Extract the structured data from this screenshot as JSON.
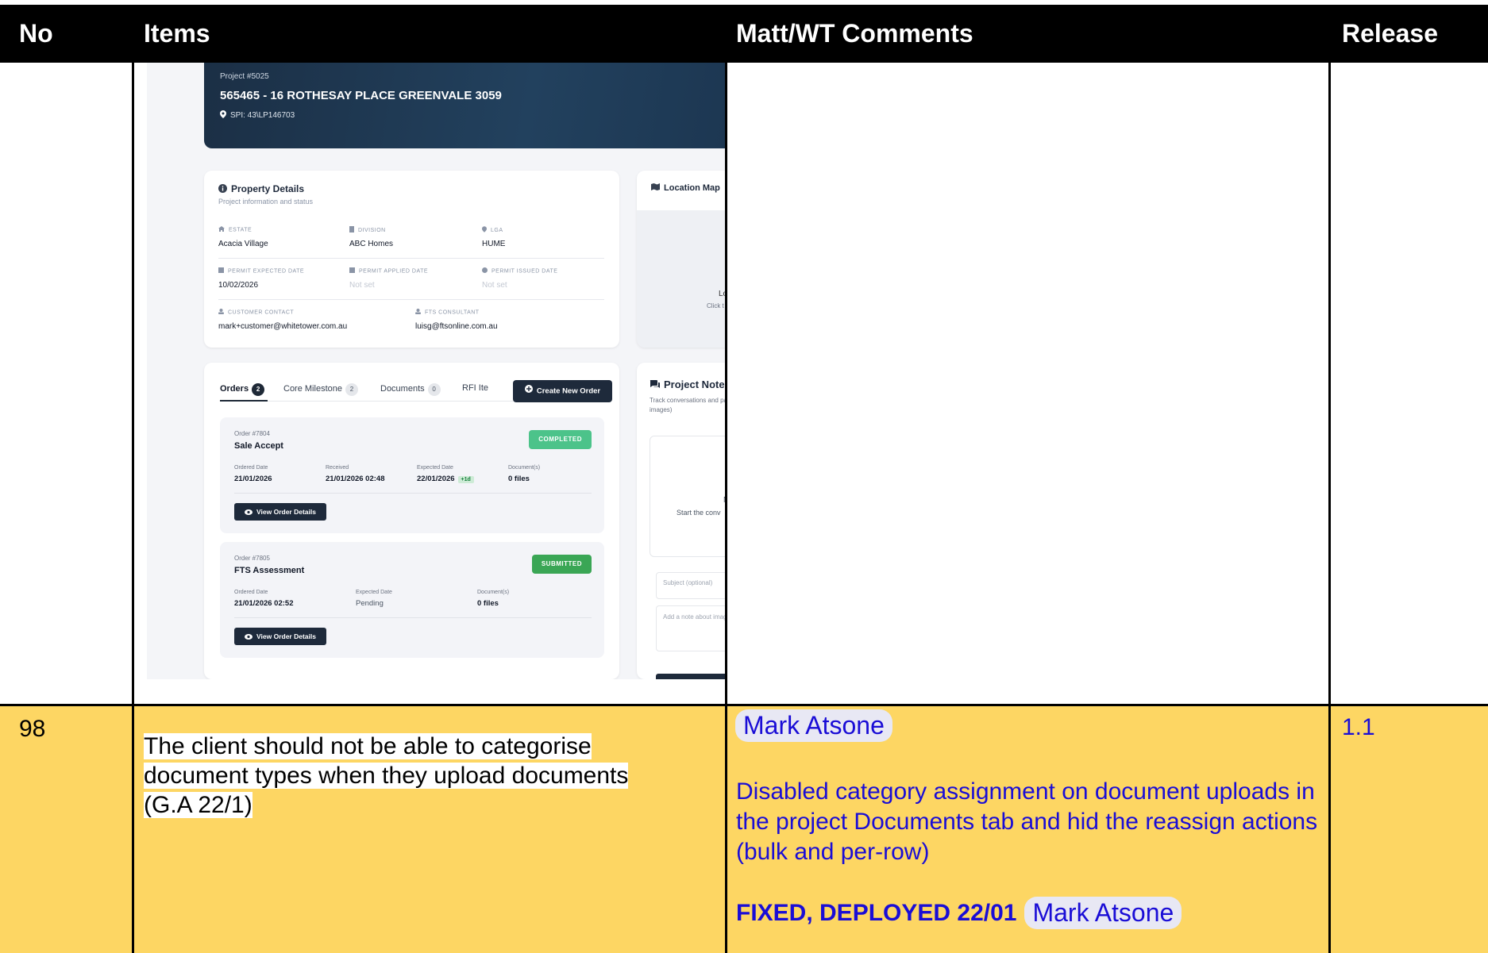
{
  "table": {
    "headers": {
      "no": "No",
      "items": "Items",
      "comments": "Matt/WT Comments",
      "release": "Release"
    },
    "row98": {
      "no": "98",
      "item": "The client should not be able to categorise document types when they upload documents (G.A 22/1)",
      "comment_author": "Mark Atsone",
      "comment_text": "Disabled category assignment on document uploads in the project Documents tab and hid the reassign actions (bulk and per-row)",
      "status": "FIXED, DEPLOYED 22/01",
      "status_author": "Mark Atsone",
      "release": "1.1"
    }
  },
  "screenshot": {
    "banner": {
      "project_no": "Project #5025",
      "address": "565465 - 16 ROTHESAY PLACE GREENVALE 3059",
      "spi": "SPI: 43\\LP146703"
    },
    "property": {
      "title": "Property Details",
      "subtitle": "Project information and status",
      "estate_label": "ESTATE",
      "estate": "Acacia Village",
      "division_label": "DIVISION",
      "division": "ABC Homes",
      "lga_label": "LGA",
      "lga": "HUME",
      "permit_expected_label": "PERMIT EXPECTED DATE",
      "permit_expected": "10/02/2026",
      "permit_applied_label": "PERMIT APPLIED DATE",
      "permit_applied": "Not set",
      "permit_issued_label": "PERMIT ISSUED DATE",
      "permit_issued": "Not set",
      "customer_label": "CUSTOMER CONTACT",
      "customer": "mark+customer@whitetower.com.au",
      "consultant_label": "FTS CONSULTANT",
      "consultant": "luisg@ftsonline.com.au"
    },
    "map": {
      "title": "Location Map",
      "lo": "Lo",
      "click": "Click t"
    },
    "tabs": {
      "orders": "Orders",
      "orders_count": "2",
      "core": "Core Milestone",
      "core_count": "2",
      "docs": "Documents",
      "docs_count": "0",
      "rfi": "RFI Ite",
      "create": "Create New Order"
    },
    "orders": [
      {
        "num": "Order #7804",
        "name": "Sale Accept",
        "status": "COMPLETED",
        "status_color": "#4cc38a",
        "l1": "Ordered Date",
        "v1": "21/01/2026",
        "l2": "Received",
        "v2": "21/01/2026 02:48",
        "l3": "Expected Date",
        "v3": "22/01/2026",
        "v3_badge": "+1d",
        "l4": "Document(s)",
        "v4": "0 files",
        "view": "View Order Details"
      },
      {
        "num": "Order #7805",
        "name": "FTS Assessment",
        "status": "SUBMITTED",
        "status_color": "#3aa655",
        "l1": "Ordered Date",
        "v1": "21/01/2026 02:52",
        "l2": "Expected Date",
        "v2": "Pending",
        "l3": "Document(s)",
        "v3": "0 files",
        "view": "View Order Details"
      }
    ],
    "notes": {
      "title": "Project Note",
      "subtitle": "Track conversations and paste images)",
      "empty1": "N",
      "empty2": "Start the conv",
      "subject_placeholder": "Subject (optional)",
      "note_placeholder": "Add a note about images)"
    }
  },
  "colors": {
    "row_highlight": "#fdd663",
    "comment_blue": "#1a0dd6",
    "header_bg": "#000000"
  }
}
